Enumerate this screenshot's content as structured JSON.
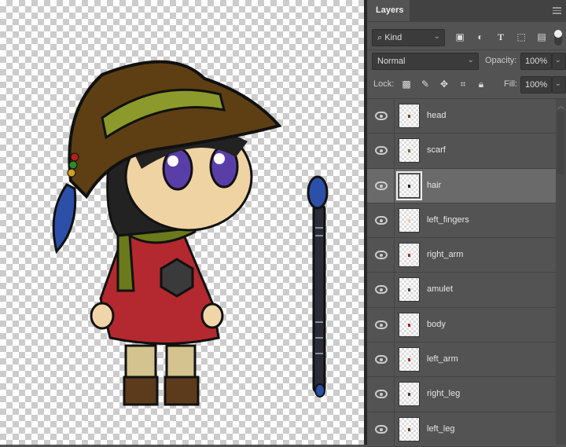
{
  "panel": {
    "title": "Layers",
    "filter": {
      "label": "Kind"
    },
    "blend_mode": "Normal",
    "opacity_label": "Opacity:",
    "opacity": "100%",
    "lock_label": "Lock:",
    "fill_label": "Fill:",
    "fill": "100%",
    "layers": [
      {
        "name": "head",
        "visible": true,
        "active": false,
        "thumb_color": "#6b4c1a"
      },
      {
        "name": "scarf",
        "visible": true,
        "active": false,
        "thumb_color": "#6b7a1a"
      },
      {
        "name": "hair",
        "visible": true,
        "active": true,
        "thumb_color": "#222222"
      },
      {
        "name": "left_fingers",
        "visible": true,
        "active": false,
        "thumb_color": "#e8cfa0"
      },
      {
        "name": "right_arm",
        "visible": true,
        "active": false,
        "thumb_color": "#a03030"
      },
      {
        "name": "amulet",
        "visible": true,
        "active": false,
        "thumb_color": "#444444"
      },
      {
        "name": "body",
        "visible": true,
        "active": false,
        "thumb_color": "#b02020"
      },
      {
        "name": "left_arm",
        "visible": true,
        "active": false,
        "thumb_color": "#a03030"
      },
      {
        "name": "right_leg",
        "visible": true,
        "active": false,
        "thumb_color": "#5a3a1a"
      },
      {
        "name": "left_leg",
        "visible": true,
        "active": false,
        "thumb_color": "#5a3a1a"
      }
    ]
  }
}
